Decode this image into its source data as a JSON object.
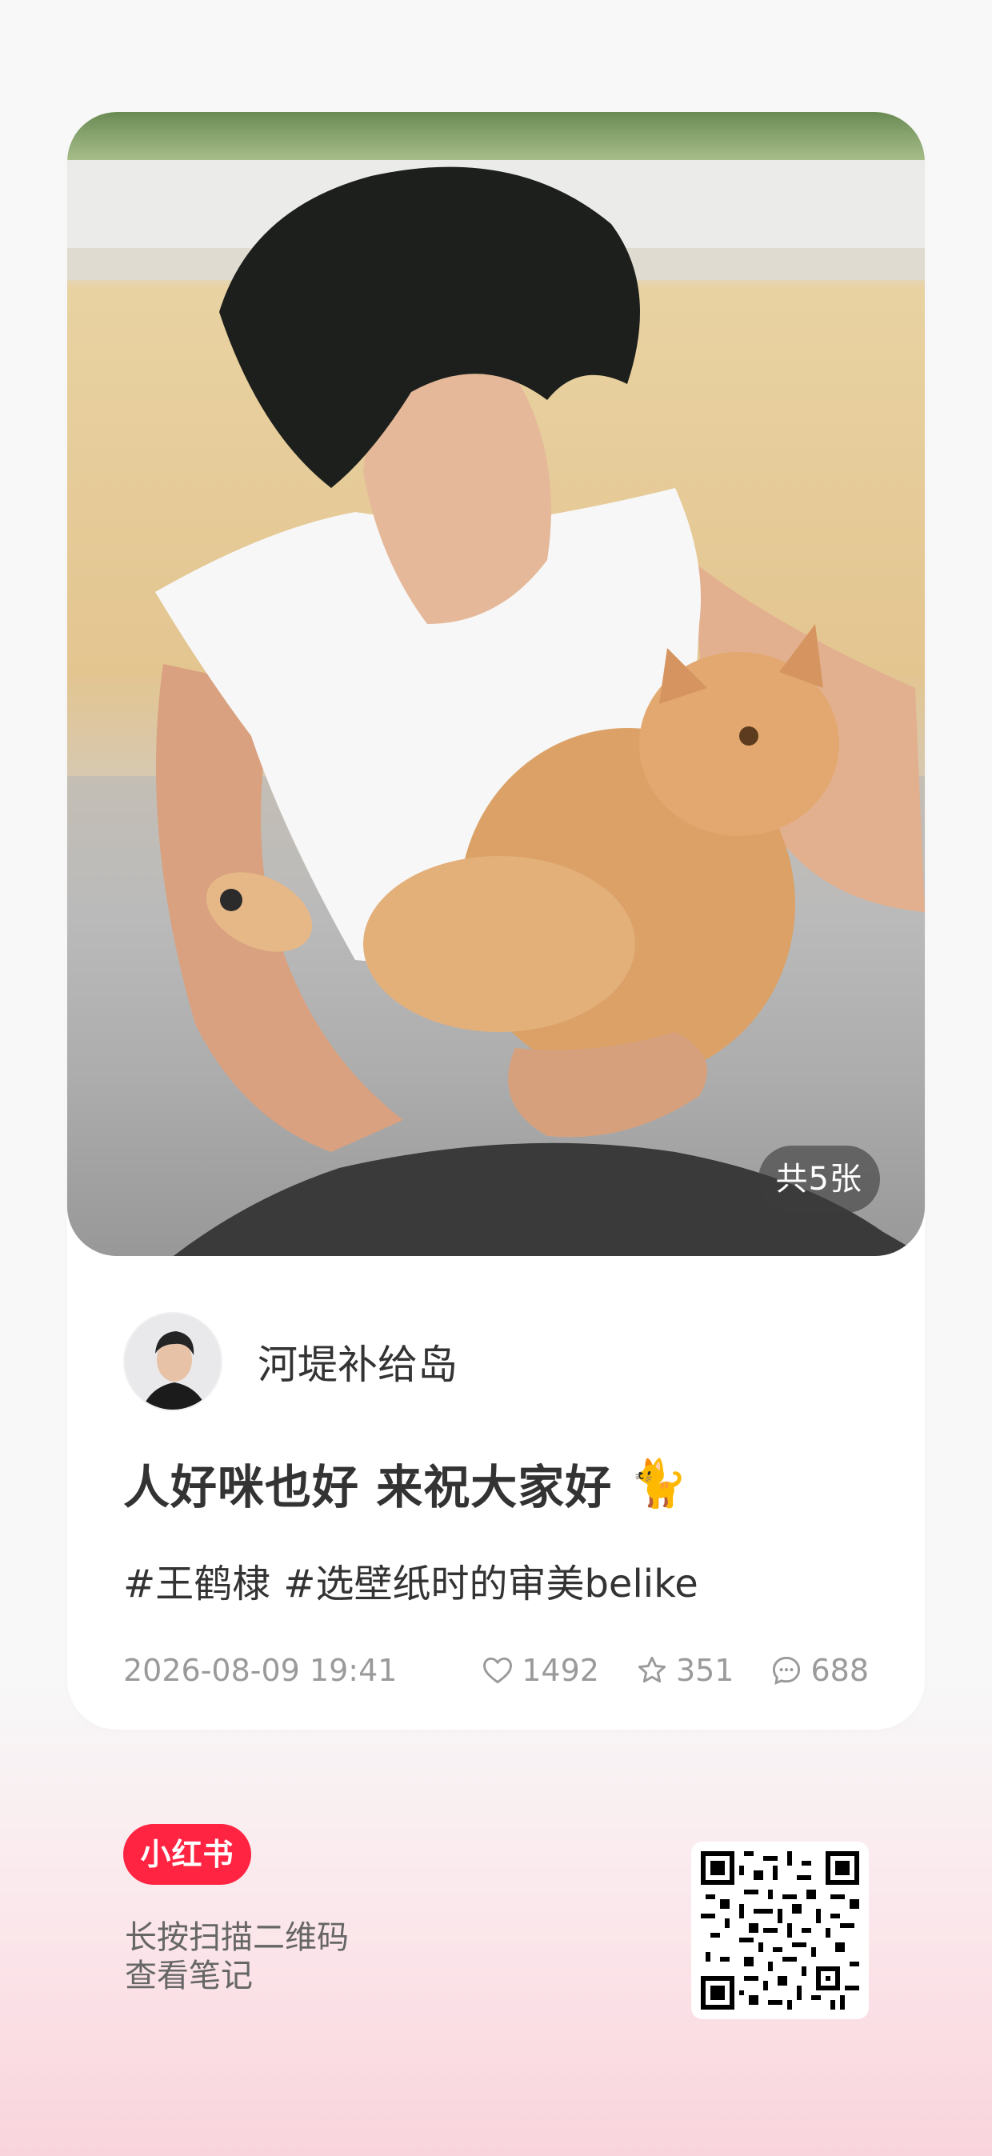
{
  "post": {
    "image_count_label": "共5张",
    "author_name": "河堤补给岛",
    "title": "人好咪也好 来祝大家好",
    "title_emoji": "🐈",
    "tags": [
      "#王鹤棣",
      "#选壁纸时的审美belike"
    ],
    "date": "2026-08-09 19:41",
    "likes": "1492",
    "collects": "351",
    "comments": "688"
  },
  "footer": {
    "logo_text": "小红书",
    "hint_line1": "长按扫描二维码",
    "hint_line2": "查看笔记"
  },
  "icons": {
    "like": "heart-icon",
    "collect": "star-icon",
    "comment": "comment-bubble-icon",
    "qr": "qr-code-icon"
  },
  "colors": {
    "brand": "#ff2442",
    "text_primary": "#333333",
    "text_secondary": "#9a9a9a"
  }
}
